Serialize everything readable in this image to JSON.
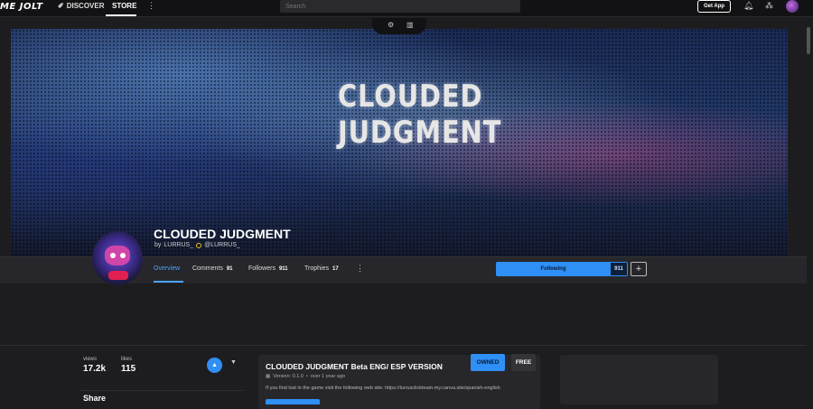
{
  "nav": {
    "logo": "ME JOLT",
    "discover": "DISCOVER",
    "store": "STORE",
    "search_placeholder": "Search",
    "get_app": "Get App"
  },
  "game": {
    "title": "CLOUDED JUDGMENT",
    "by_prefix": "by",
    "author": "LURRUS_",
    "author_handle": "@LURRUS_",
    "banner_line1": "CLOUDED",
    "banner_line2": "JUDGMENT"
  },
  "tabs": [
    {
      "label": "Overview",
      "count": ""
    },
    {
      "label": "Comments",
      "count": "91"
    },
    {
      "label": "Followers",
      "count": "911"
    },
    {
      "label": "Trophies",
      "count": "17"
    }
  ],
  "follow": {
    "label": "Following",
    "count": "911"
  },
  "stats": {
    "views_label": "views",
    "views": "17.2k",
    "likes_label": "likes",
    "likes": "115"
  },
  "share_label": "Share",
  "package": {
    "title": "CLOUDED JUDGMENT Beta ENG/ ESP VERSION",
    "version": "Version: 0.1.0",
    "age": "over 1 year ago",
    "description": "If you find lost in the game visit the following web site: https://lurrusclickteam.my.canva.site/spanish-english",
    "owned": "OWNED",
    "price": "FREE"
  }
}
